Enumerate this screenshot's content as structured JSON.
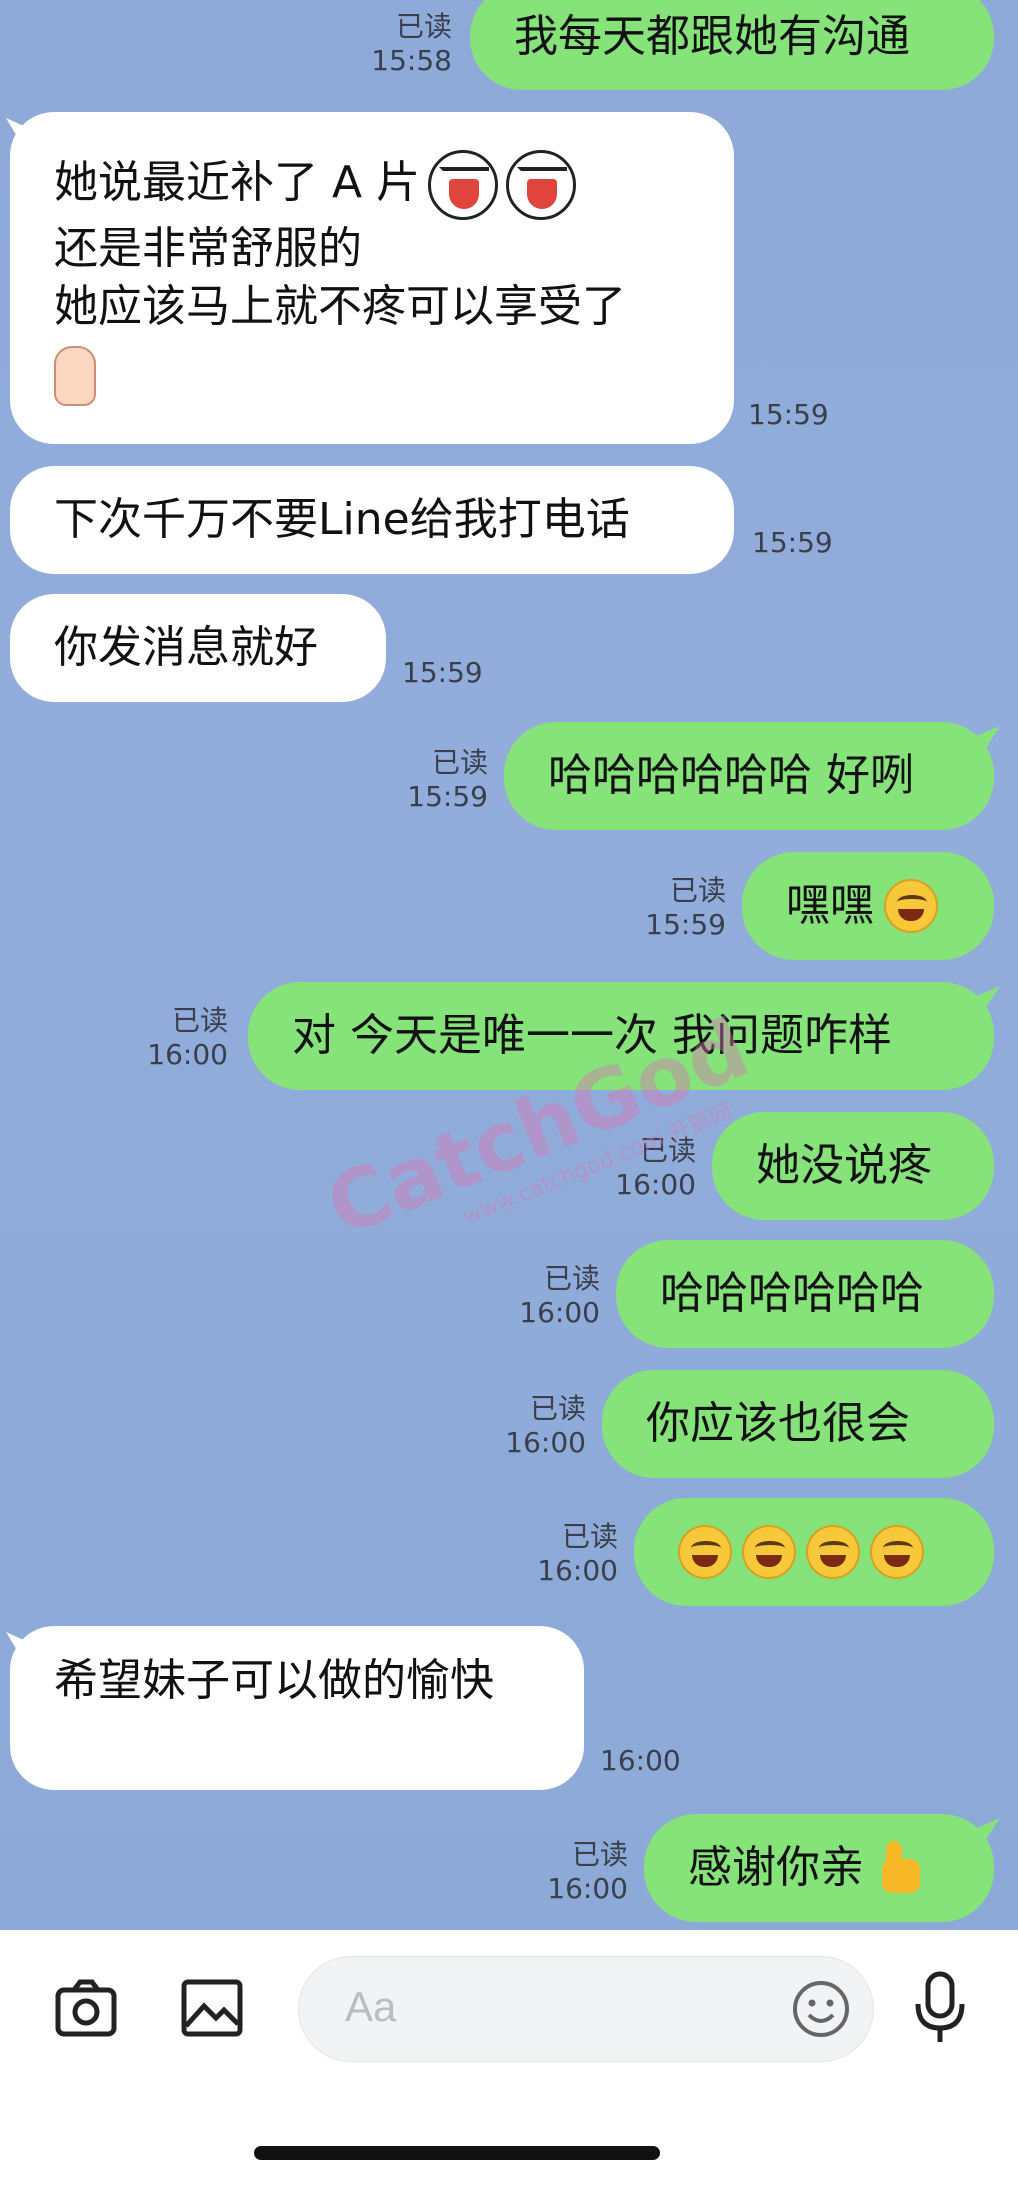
{
  "messages": [
    {
      "dir": "out",
      "read": "已读",
      "time": "15:58",
      "text": "我每天都跟她有沟通"
    },
    {
      "dir": "in",
      "time": "15:59",
      "lines": [
        "她说最近补了 A 片",
        "还是非常舒服的",
        "她应该马上就不疼可以享受了"
      ]
    },
    {
      "dir": "in",
      "time": "15:59",
      "text": "下次千万不要Line给我打电话"
    },
    {
      "dir": "in",
      "time": "15:59",
      "text": "你发消息就好"
    },
    {
      "dir": "out",
      "read": "已读",
      "time": "15:59",
      "text": "哈哈哈哈哈哈 好咧"
    },
    {
      "dir": "out",
      "read": "已读",
      "time": "15:59",
      "text": "嘿嘿"
    },
    {
      "dir": "out",
      "read": "已读",
      "time": "16:00",
      "text": "对 今天是唯一一次 我问题咋样"
    },
    {
      "dir": "out",
      "read": "已读",
      "time": "16:00",
      "text": "她没说疼"
    },
    {
      "dir": "out",
      "read": "已读",
      "time": "16:00",
      "text": "哈哈哈哈哈哈"
    },
    {
      "dir": "out",
      "read": "已读",
      "time": "16:00",
      "text": "你应该也很会"
    },
    {
      "dir": "out",
      "read": "已读",
      "time": "16:00",
      "text": ""
    },
    {
      "dir": "in",
      "time": "16:00",
      "text": "希望妹子可以做的愉快"
    },
    {
      "dir": "out",
      "read": "已读",
      "time": "16:00",
      "text": "感谢你亲"
    }
  ],
  "watermark": {
    "text": "CatchGod",
    "url": "www.catchgod.com 开搞网"
  },
  "input": {
    "placeholder": "Aa"
  }
}
